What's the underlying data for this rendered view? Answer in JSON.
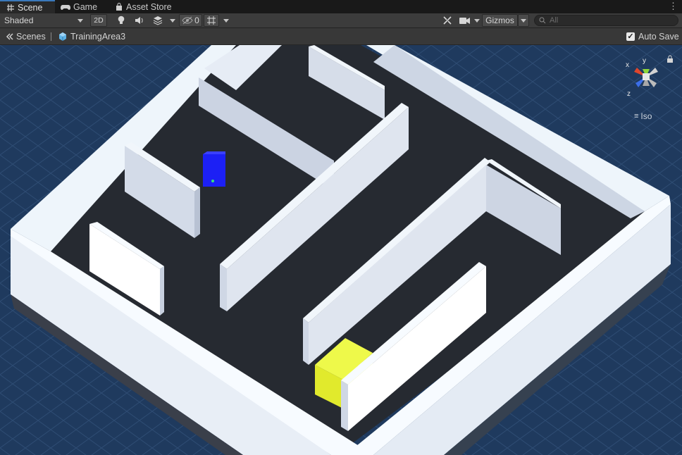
{
  "tabs": [
    {
      "label": "Scene",
      "icon": "grid-icon",
      "active": true
    },
    {
      "label": "Game",
      "icon": "gamepad-icon",
      "active": false
    },
    {
      "label": "Asset Store",
      "icon": "bag-icon",
      "active": false
    }
  ],
  "toolbar": {
    "shading_mode": "Shaded",
    "mode_2d_label": "2D",
    "hidden_count": "0",
    "gizmos_label": "Gizmos"
  },
  "search": {
    "placeholder": "All"
  },
  "breadcrumb": {
    "scenes_label": "Scenes",
    "current_scene": "TrainingArea3"
  },
  "auto_save": {
    "label": "Auto Save",
    "checked": true
  },
  "scene_gizmo": {
    "projection_label": "Iso",
    "axes": [
      "x",
      "y",
      "z"
    ]
  },
  "colors": {
    "accent_tab": "#3a79bb",
    "floor": "#262a31",
    "wall": "#d9e1ee",
    "agent_cube": "#1c20f5",
    "goal_cube": "#e8f53a",
    "grid_background": "#1f3a5e"
  }
}
